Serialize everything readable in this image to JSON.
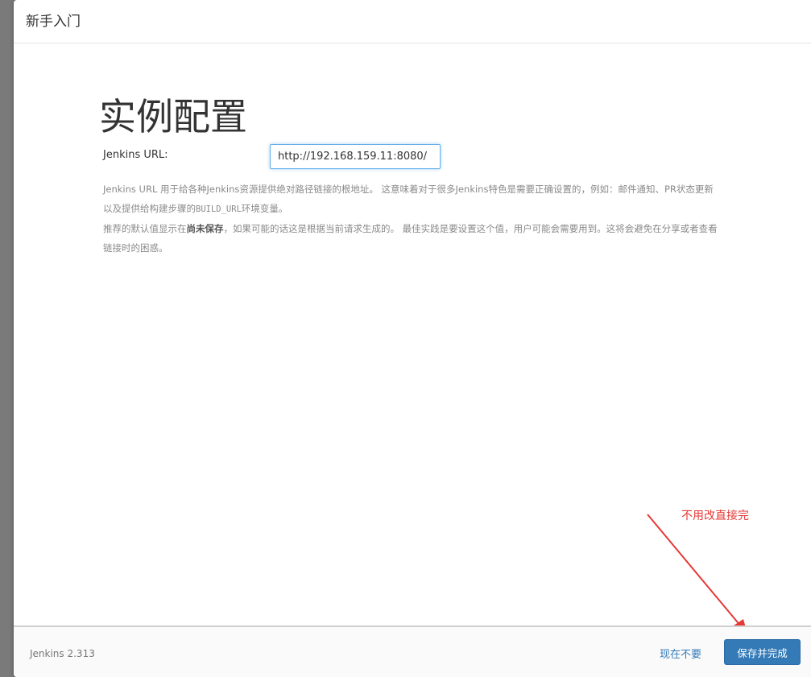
{
  "header": {
    "title": "新手入门"
  },
  "main": {
    "title": "实例配置",
    "url_label": "Jenkins URL:",
    "url_value": "http://192.168.159.11:8080/",
    "help_p1_a": "Jenkins URL 用于给各种Jenkins资源提供绝对路径链接的根地址。 这意味着对于很多Jenkins特色是需要正确设置的，例如：邮件通知、PR状态更新以及提供给构建步骤的",
    "help_p1_code": "BUILD_URL",
    "help_p1_b": "环境变量。",
    "help_p2_a": "推荐的默认值显示在",
    "help_p2_strong": "尚未保存",
    "help_p2_b": "，如果可能的话这是根据当前请求生成的。 最佳实践是要设置这个值，用户可能会需要用到。这将会避免在分享或者查看链接时的困惑。"
  },
  "annotation": {
    "text": "不用改直接完",
    "color": "#e53935"
  },
  "footer": {
    "version": "Jenkins 2.313",
    "skip_label": "现在不要",
    "save_label": "保存并完成"
  },
  "colors": {
    "primary": "#337ab7",
    "input_focus": "#66afe9"
  }
}
